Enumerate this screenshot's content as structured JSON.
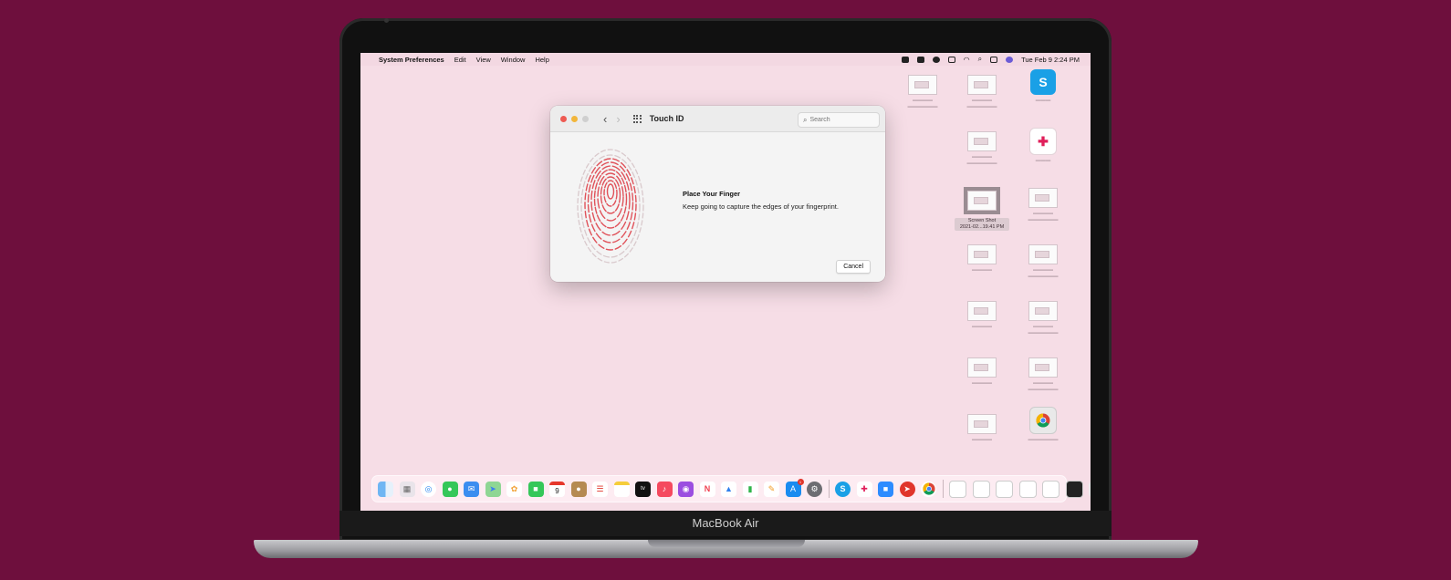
{
  "device": {
    "label": "MacBook Air"
  },
  "menubar": {
    "apple_glyph": "",
    "app_name": "System Preferences",
    "menus": [
      "Edit",
      "View",
      "Window",
      "Help"
    ],
    "datetime": "Tue Feb 9  2:24 PM"
  },
  "window": {
    "title": "Touch ID",
    "search_placeholder": "Search",
    "prompt_title": "Place Your Finger",
    "prompt_text": "Keep going to capture the edges of your fingerprint.",
    "cancel_label": "Cancel"
  },
  "desktop": {
    "selected_file": {
      "line1": "Screen Shot",
      "line2": "2021-02...19.41 PM"
    }
  },
  "dock": {
    "calendar_day": "9",
    "app_store_badge": "1"
  },
  "colors": {
    "background": "#6e0f3d",
    "screen": "#f6dde6",
    "fingerprint": "#e0525a"
  }
}
